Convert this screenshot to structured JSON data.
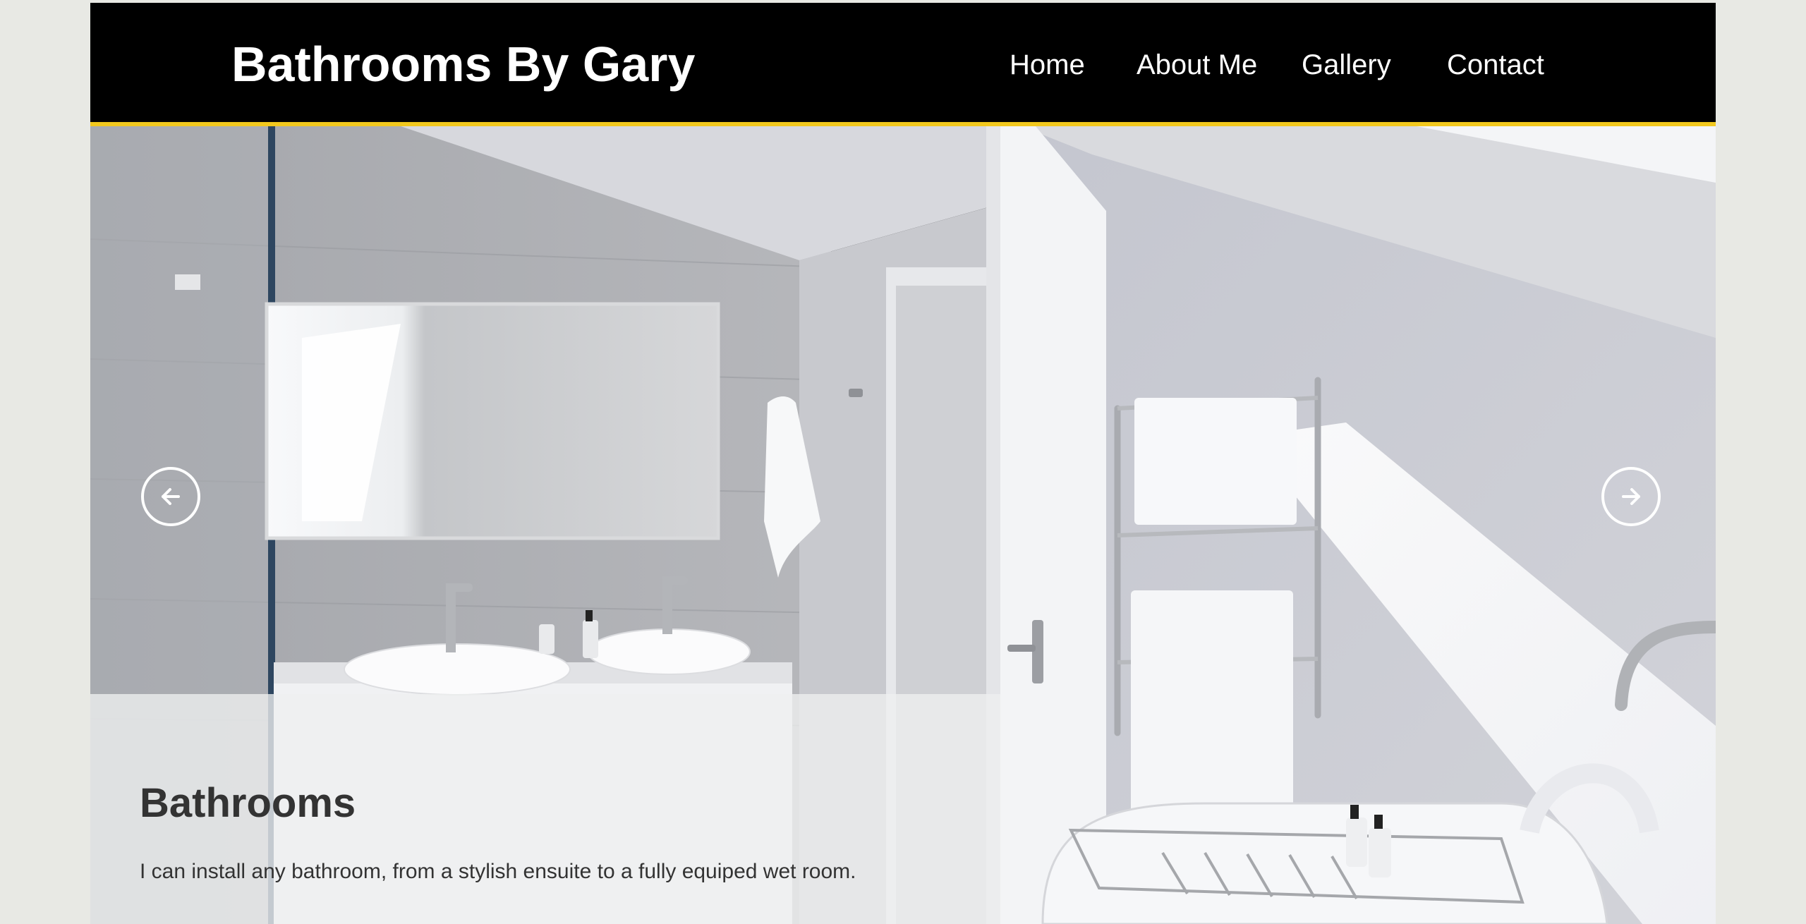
{
  "header": {
    "site_title": "Bathrooms By Gary",
    "accent_color": "#f2c81e",
    "background_color": "#000000"
  },
  "nav": {
    "items": [
      {
        "label": "Home"
      },
      {
        "label": "About Me"
      },
      {
        "label": "Gallery"
      },
      {
        "label": "Contact"
      }
    ]
  },
  "hero": {
    "image": "bathroom-interior-photo",
    "prev_icon": "arrow-left-icon",
    "next_icon": "arrow-right-icon",
    "caption": {
      "title": "Bathrooms",
      "text": "I can install any bathroom, from a stylish ensuite to a fully equiped wet room."
    }
  }
}
